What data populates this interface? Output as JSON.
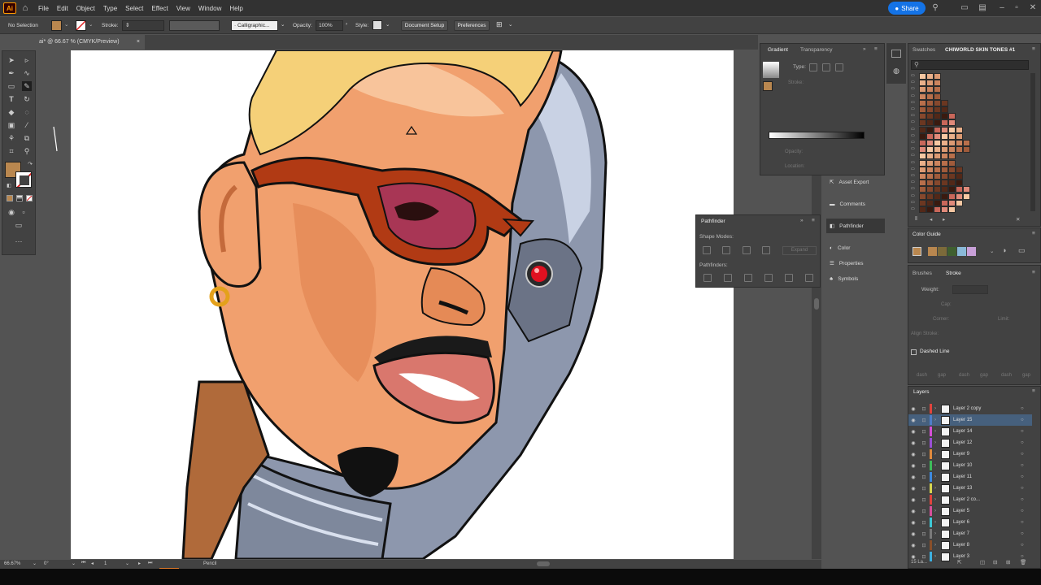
{
  "app": {
    "logo": "Ai"
  },
  "menu": {
    "items": [
      "File",
      "Edit",
      "Object",
      "Type",
      "Select",
      "Effect",
      "View",
      "Window",
      "Help"
    ]
  },
  "share": {
    "label": "Share"
  },
  "control": {
    "selection": "No Selection",
    "stroke_label": "Stroke:",
    "brush": "Calligraphic...",
    "opacity_label": "Opacity:",
    "opacity_value": "100%",
    "style_label": "Style:",
    "doc_setup": "Document Setup",
    "preferences": "Preferences"
  },
  "doc": {
    "tab": "ai* @ 66.67 % (CMYK/Preview)",
    "close": "×"
  },
  "gradient_panel": {
    "tabs": [
      "Gradient",
      "Transparency"
    ],
    "type_label": "Type:",
    "stroke_label": "Stroke:",
    "opacity_label": "Opacity:",
    "location_label": "Location:"
  },
  "pathfinder": {
    "title": "Pathfinder",
    "shape_modes": "Shape Modes:",
    "pathfinders": "Pathfinders:",
    "expand": "Expand"
  },
  "side_buttons": [
    "Asset Export",
    "Comments",
    "Pathfinder",
    "Color",
    "Properties",
    "Symbols"
  ],
  "swatches": {
    "tabs": [
      "Swatches",
      "CHIWORLD SKIN TONES #1"
    ]
  },
  "color_guide": {
    "title": "Color Guide"
  },
  "stroke_panel": {
    "tabs": [
      "Brushes",
      "Stroke"
    ],
    "weight_label": "Weight:",
    "cap_label": "Cap:",
    "corner_label": "Corner:",
    "limit_label": "Limit:",
    "align_label": "Align Stroke:",
    "dashed": "Dashed Line",
    "dash_labels": [
      "dash",
      "gap",
      "dash",
      "gap",
      "dash",
      "gap"
    ]
  },
  "layers": {
    "title": "Layers",
    "count": "15 La...",
    "items": [
      {
        "name": "Layer 2 copy",
        "color": "#e0443d"
      },
      {
        "name": "Layer 15",
        "color": "#4f7ec8"
      },
      {
        "name": "Layer 14",
        "color": "#d64fd6"
      },
      {
        "name": "Layer 12",
        "color": "#9a4fd6"
      },
      {
        "name": "Layer 9",
        "color": "#e08a3d"
      },
      {
        "name": "Layer 10",
        "color": "#3dbd5a"
      },
      {
        "name": "Layer 11",
        "color": "#3d8ae0"
      },
      {
        "name": "Layer 13",
        "color": "#d6d64f"
      },
      {
        "name": "Layer 2 co...",
        "color": "#e0443d"
      },
      {
        "name": "Layer 5",
        "color": "#d64f9a"
      },
      {
        "name": "Layer 6",
        "color": "#3dc8d6"
      },
      {
        "name": "Layer 7",
        "color": "#7a7a7a"
      },
      {
        "name": "Layer 8",
        "color": "#8a4f2a"
      },
      {
        "name": "Layer 3",
        "color": "#3db0e0"
      }
    ]
  },
  "status": {
    "zoom": "66.67%",
    "rotation": "0°",
    "artboard": "1",
    "tool": "Pencil"
  },
  "colors": {
    "fill": "#b9874f",
    "accent": "#1473e6"
  }
}
